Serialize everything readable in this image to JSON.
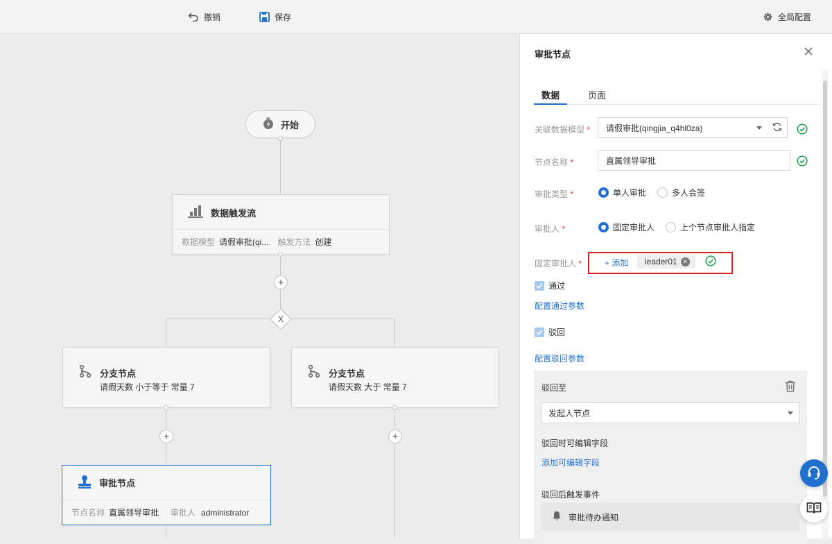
{
  "toolbar": {
    "undo_label": "撤销",
    "save_label": "保存",
    "global_config_label": "全局配置"
  },
  "flow": {
    "start_label": "开始",
    "trigger_node": {
      "title": "数据触发流",
      "model_label": "数据模型",
      "model_value": "请假审批(qi...",
      "method_label": "触发方法",
      "method_value": "创建"
    },
    "gateway_symbol": "X",
    "branch_left": {
      "title": "分支节点",
      "condition": "请假天数 小于等于 常量 7"
    },
    "branch_right": {
      "title": "分支节点",
      "condition": "请假天数 大于 常量 7"
    },
    "approval_node": {
      "title": "审批节点",
      "name_label": "节点名称",
      "name_value": "直属领导审批",
      "approver_label": "审批人",
      "approver_value": "administrator"
    }
  },
  "panel": {
    "title": "审批节点",
    "tabs": [
      {
        "label": "数据",
        "active": true
      },
      {
        "label": "页面",
        "active": false
      }
    ],
    "fields": {
      "data_model_label": "关联数据模型",
      "data_model_value": "请假审批(qingjia_q4hl0za)",
      "node_name_label": "节点名称",
      "node_name_value": "直属领导审批",
      "approval_type_label": "审批类型",
      "approval_type_options": [
        "单人审批",
        "多人会签"
      ],
      "approval_type_selected": "单人审批",
      "approver_label": "审批人",
      "approver_options": [
        "固定审批人",
        "上个节点审批人指定"
      ],
      "approver_selected": "固定审批人",
      "fixed_approver_label": "固定审批人",
      "add_label": "+ 添加",
      "approver_tag": "leader01",
      "required_mark": "*"
    },
    "pass": {
      "checkbox_label": "通过",
      "checked": true,
      "config_link": "配置通过参数"
    },
    "reject": {
      "checkbox_label": "驳回",
      "checked": true,
      "config_link": "配置驳回参数",
      "reject_to_label": "驳回至",
      "reject_to_value": "发起人节点",
      "editable_fields_label": "驳回时可编辑字段",
      "add_editable_link": "添加可编辑字段",
      "after_event_label": "驳回后触发事件",
      "event_item": "审批待办通知"
    }
  },
  "colors": {
    "accent": "#1f6fce",
    "success": "#22a352",
    "required": "#e0363a",
    "highlight_box": "#e02020"
  }
}
